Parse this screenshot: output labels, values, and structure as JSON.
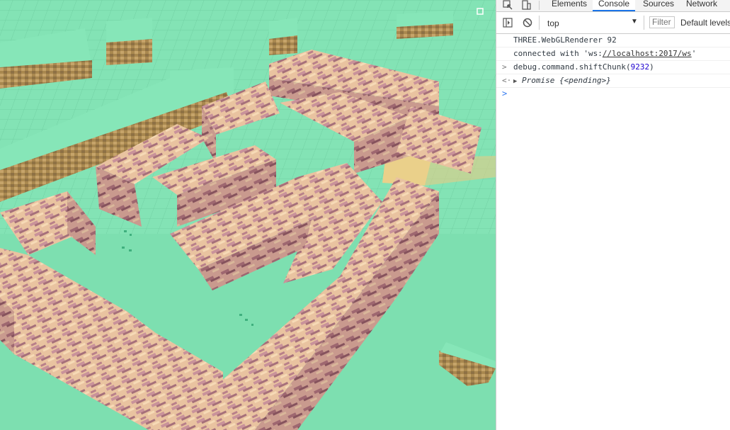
{
  "devtools": {
    "tabs": [
      "Elements",
      "Console",
      "Sources",
      "Network"
    ],
    "active_tab": "Console",
    "context": "top",
    "filter_placeholder": "Filter",
    "levels": "Default levels",
    "messages": [
      {
        "text": "THREE.WebGLRenderer 92"
      },
      {
        "prefix": "connected with 'ws:",
        "link": "//localhost:2017/ws",
        "suffix": "'"
      },
      {
        "arrow": ">",
        "command": "debug.command.shiftChunk(",
        "arg": "9232",
        "close": ")"
      },
      {
        "arrow": "<·",
        "expand": "▶",
        "label": "Promise",
        "detail": "{<pending>}"
      }
    ],
    "prompt": ">"
  },
  "colors": {
    "grass_top": "#7ddfb0",
    "dirt": "#b99a60",
    "block_light": "#f0caa0",
    "block_dark": "#a6707a",
    "accent_tab": "#1a73e8"
  },
  "icons": [
    "inspect-icon",
    "device-icon",
    "sidebar-toggle-icon",
    "clear-console-icon",
    "crosshair-icon"
  ]
}
